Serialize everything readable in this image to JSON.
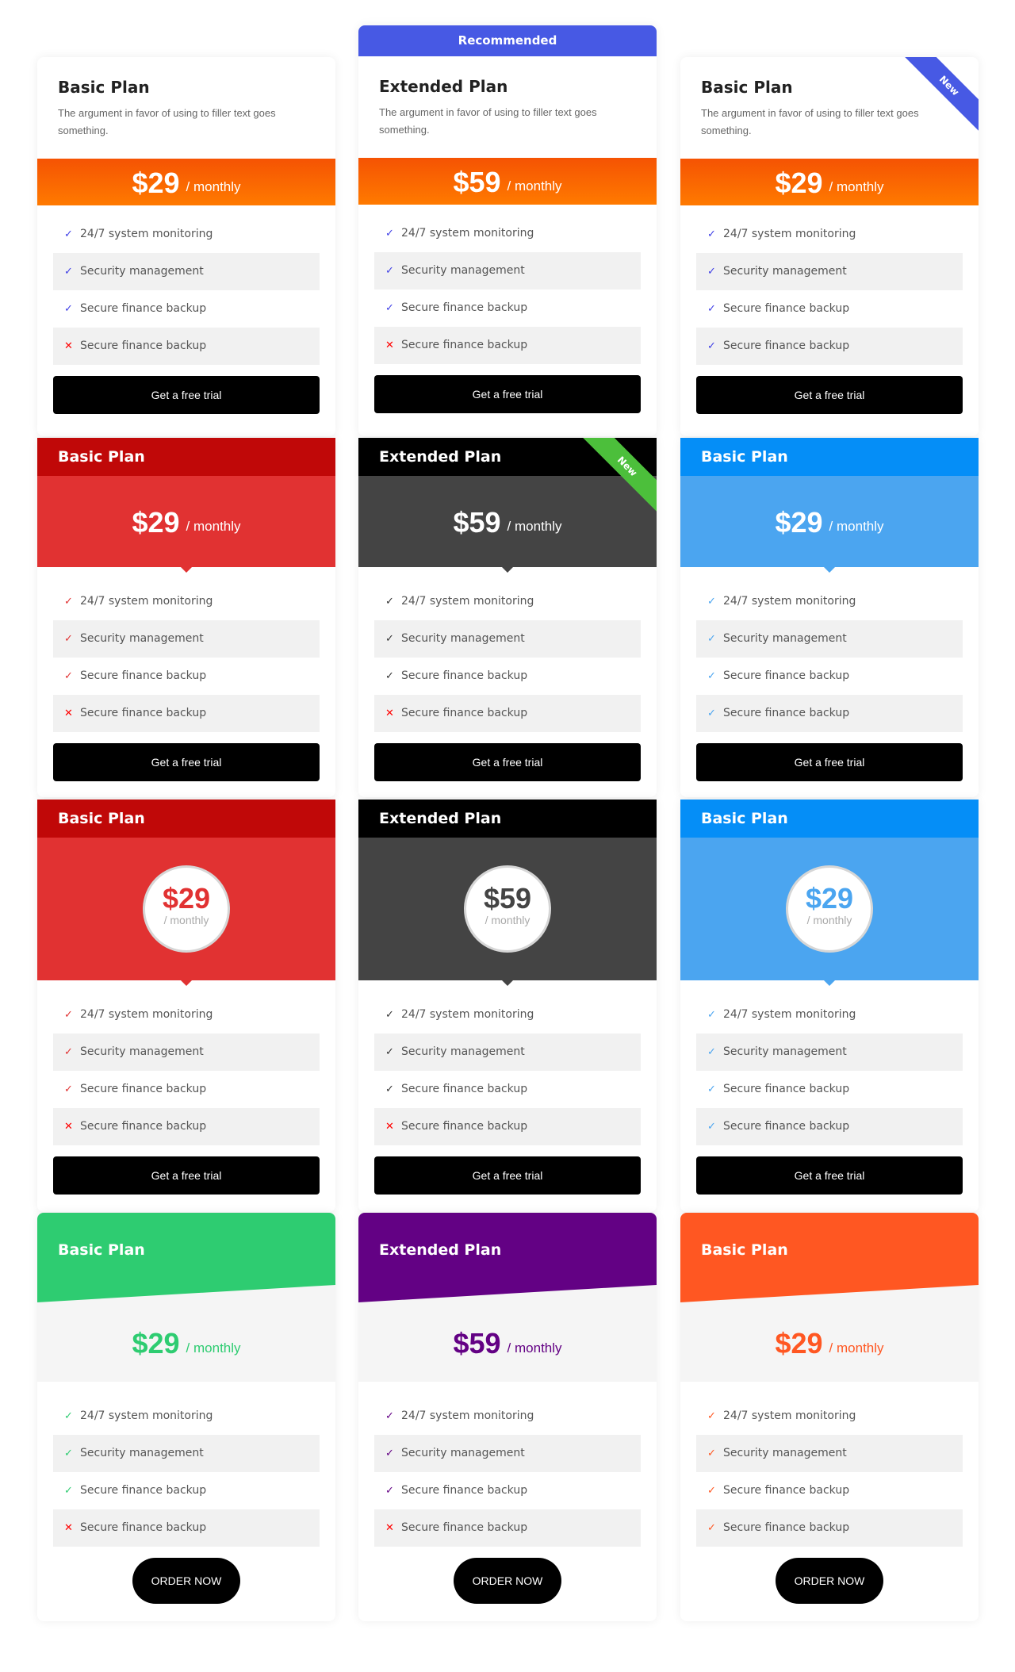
{
  "description": "The argument in favor of using to filler text goes something.",
  "per_label": "/ monthly",
  "trial_label": "Get a free trial",
  "order_label": "ORDER NOW",
  "recommended_label": "Recommended",
  "new_badge": "New",
  "features": [
    "24/7 system monitoring",
    "Security management",
    "Secure finance backup",
    "Secure finance backup"
  ],
  "colors": {
    "row1_accent": "#3f3fe6",
    "red_header": "#c00808",
    "red_body": "#e13232",
    "black_header": "#000000",
    "gray_body": "#444444",
    "blue_header": "#058ef7",
    "blue_body": "#4ba5f0",
    "green": "#2ecc71",
    "purple": "#630184",
    "orange": "#ff5722",
    "ribbon_blue": "#4759e4",
    "ribbon_green": "#4cbf3b"
  },
  "rows": [
    {
      "style": "classic",
      "cards": [
        {
          "title": "Basic Plan",
          "price": "$29",
          "feature_status": [
            "check",
            "check",
            "check",
            "cross"
          ]
        },
        {
          "title": "Extended Plan",
          "price": "$59",
          "feature_status": [
            "check",
            "check",
            "check",
            "cross"
          ],
          "banner": "Recommended"
        },
        {
          "title": "Basic Plan",
          "price": "$29",
          "feature_status": [
            "check",
            "check",
            "check",
            "check"
          ],
          "badge": "New"
        }
      ]
    },
    {
      "style": "colored",
      "cards": [
        {
          "title": "Basic Plan",
          "price": "$29",
          "feature_status": [
            "check",
            "check",
            "check",
            "cross"
          ]
        },
        {
          "title": "Extended Plan",
          "price": "$59",
          "feature_status": [
            "check",
            "check",
            "check",
            "cross"
          ],
          "badge": "New"
        },
        {
          "title": "Basic Plan",
          "price": "$29",
          "feature_status": [
            "check",
            "check",
            "check",
            "check"
          ]
        }
      ]
    },
    {
      "style": "circle",
      "cards": [
        {
          "title": "Basic Plan",
          "price": "$29",
          "feature_status": [
            "check",
            "check",
            "check",
            "cross"
          ]
        },
        {
          "title": "Extended Plan",
          "price": "$59",
          "feature_status": [
            "check",
            "check",
            "check",
            "cross"
          ]
        },
        {
          "title": "Basic Plan",
          "price": "$29",
          "feature_status": [
            "check",
            "check",
            "check",
            "check"
          ]
        }
      ]
    },
    {
      "style": "slanted",
      "cards": [
        {
          "title": "Basic Plan",
          "price": "$29",
          "feature_status": [
            "check",
            "check",
            "check",
            "cross"
          ]
        },
        {
          "title": "Extended Plan",
          "price": "$59",
          "feature_status": [
            "check",
            "check",
            "check",
            "cross"
          ]
        },
        {
          "title": "Basic Plan",
          "price": "$29",
          "feature_status": [
            "check",
            "check",
            "check",
            "check"
          ]
        }
      ]
    }
  ]
}
